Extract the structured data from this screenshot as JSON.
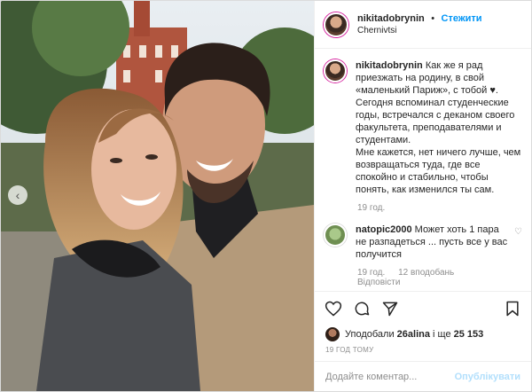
{
  "header": {
    "username": "nikitadobrynin",
    "separator": "•",
    "follow_label": "Стежити",
    "location": "Chernivtsi"
  },
  "caption": {
    "username": "nikitadobrynin",
    "text": "Как же я рад приезжать на родину, в свой «маленький Париж», с тобой ♥.\nСегодня вспоминал студенческие годы, встречался с деканом своего факультета, преподавателями и студентами.\nМне кажется, нет ничего лучше, чем возвращаться туда, где все спокойно и стабильно, чтобы понять, как изменился ты сам.",
    "time": "19 год."
  },
  "comments": [
    {
      "username": "natopic2000",
      "text": "Может хоть 1 пара не разпадеться ... пусть все у вас получится",
      "time": "19 год.",
      "likes": "12 вподобань",
      "reply": "Відповісти"
    }
  ],
  "likes": {
    "prefix": "Уподобали",
    "user": "26alina",
    "suffix": "і ще",
    "count": "25 153"
  },
  "timestamp": "19 ГОД ТОМУ",
  "add_comment": {
    "placeholder": "Додайте коментар...",
    "publish_label": "Опублікувати"
  },
  "icons": [
    "heart-icon",
    "comment-icon",
    "share-icon",
    "bookmark-icon",
    "chevron-left-icon"
  ],
  "colors": {
    "link": "#0095f6",
    "publish_disabled": "#b2dffc",
    "muted": "#8e8e8e"
  }
}
